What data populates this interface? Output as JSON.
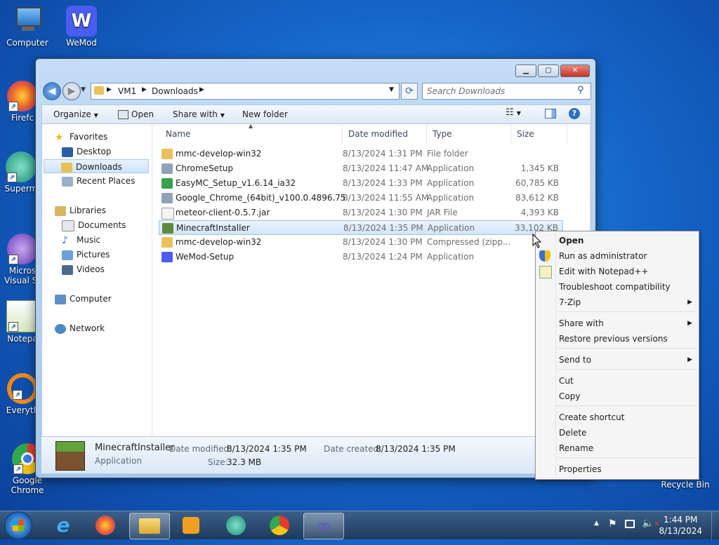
{
  "desktop": {
    "icons": [
      {
        "label": "Computer"
      },
      {
        "label": "WeMod"
      },
      {
        "label": "Firefc"
      },
      {
        "label": "Superm"
      },
      {
        "label": "Micros\nVisual St"
      },
      {
        "label": "Notepa"
      },
      {
        "label": "Everyth"
      },
      {
        "label": "Google\nChrome"
      },
      {
        "label": "Recycle Bin"
      }
    ]
  },
  "window": {
    "breadcrumb": [
      "VM1",
      "Downloads"
    ],
    "search_placeholder": "Search Downloads",
    "toolbar": {
      "organize": "Organize",
      "open": "Open",
      "share_with": "Share with",
      "new_folder": "New folder"
    },
    "nav": {
      "favorites": "Favorites",
      "desktop": "Desktop",
      "downloads": "Downloads",
      "recent": "Recent Places",
      "libraries": "Libraries",
      "documents": "Documents",
      "music": "Music",
      "pictures": "Pictures",
      "videos": "Videos",
      "computer": "Computer",
      "network": "Network"
    },
    "columns": {
      "name": "Name",
      "date": "Date modified",
      "type": "Type",
      "size": "Size"
    },
    "files": [
      {
        "name": "mmc-develop-win32",
        "date": "8/13/2024 1:31 PM",
        "type": "File folder",
        "size": "",
        "icon": "folder-icon",
        "color": "#e8c15a"
      },
      {
        "name": "ChromeSetup",
        "date": "8/13/2024 11:47 AM",
        "type": "Application",
        "size": "1,345 KB",
        "icon": "installer-icon",
        "color": "#8fa3b8"
      },
      {
        "name": "EasyMC_Setup_v1.6.14_ia32",
        "date": "8/13/2024 1:33 PM",
        "type": "Application",
        "size": "60,785 KB",
        "icon": "package-icon",
        "color": "#3aa04a"
      },
      {
        "name": "Google_Chrome_(64bit)_v100.0.4896.75",
        "date": "8/13/2024 11:55 AM",
        "type": "Application",
        "size": "83,612 KB",
        "icon": "installer-icon",
        "color": "#8fa3b8"
      },
      {
        "name": "meteor-client-0.5.7.jar",
        "date": "8/13/2024 1:30 PM",
        "type": "JAR File",
        "size": "4,393 KB",
        "icon": "file-icon",
        "color": "#f4f4f4"
      },
      {
        "name": "MinecraftInstaller",
        "date": "8/13/2024 1:35 PM",
        "type": "Application",
        "size": "33,102 KB",
        "icon": "minecraft-icon",
        "color": "#5b8a3a"
      },
      {
        "name": "mmc-develop-win32",
        "date": "8/13/2024 1:30 PM",
        "type": "Compressed (zipp...",
        "size": "1",
        "icon": "zip-folder-icon",
        "color": "#e8c15a"
      },
      {
        "name": "WeMod-Setup",
        "date": "8/13/2024 1:24 PM",
        "type": "Application",
        "size": "",
        "icon": "wemod-icon",
        "color": "#4a5df0"
      }
    ],
    "details": {
      "name": "MinecraftInstaller",
      "kind": "Application",
      "date_modified_label": "Date modified:",
      "date_modified": "8/13/2024 1:35 PM",
      "date_created_label": "Date created:",
      "date_created": "8/13/2024 1:35 PM",
      "size_label": "Size:",
      "size": "32.3 MB"
    }
  },
  "context_menu": {
    "open": "Open",
    "run_admin": "Run as administrator",
    "edit_notepad": "Edit with Notepad++",
    "troubleshoot": "Troubleshoot compatibility",
    "seven_zip": "7-Zip",
    "share_with": "Share with",
    "restore": "Restore previous versions",
    "send_to": "Send to",
    "cut": "Cut",
    "copy": "Copy",
    "create_shortcut": "Create shortcut",
    "delete": "Delete",
    "rename": "Rename",
    "properties": "Properties"
  },
  "taskbar": {
    "time": "1:44 PM",
    "date": "8/13/2024"
  }
}
